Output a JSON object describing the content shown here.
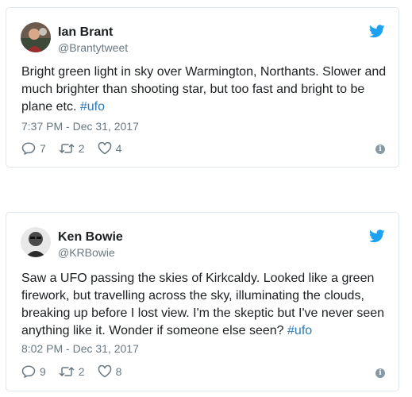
{
  "tweets": [
    {
      "name": "Ian Brant",
      "handle": "@Brantytweet",
      "text": "Bright green light in sky over Warmington, Northants. Slower and much brighter than shooting star, but too fast and bright to be plane etc. ",
      "hashtag": "#ufo",
      "timestamp": "7:37 PM - Dec 31, 2017",
      "replies": "7",
      "retweets": "2",
      "likes": "4",
      "avatar_icon": "profile-photo-icon"
    },
    {
      "name": "Ken Bowie",
      "handle": "@KRBowie",
      "text": "Saw a UFO passing the skies of Kirkcaldy. Looked like a green firework, but travelling across the sky, illuminating the clouds, breaking up before I lost view. I'm the skeptic but I've never seen anything like it. Wonder if someone else seen? ",
      "hashtag": "#ufo",
      "timestamp": "8:02 PM - Dec 31, 2017",
      "replies": "9",
      "retweets": "2",
      "likes": "8",
      "avatar_icon": "profile-photo-icon"
    }
  ],
  "colors": {
    "text": "#1c2022",
    "muted": "#697882",
    "link": "#2b7bb9",
    "twitter_blue": "#1da1f2",
    "border": "#e1e8ed"
  },
  "icons": {
    "brand": "twitter-bird-icon",
    "reply": "reply-icon",
    "retweet": "retweet-icon",
    "like": "heart-icon",
    "info": "info-icon"
  }
}
